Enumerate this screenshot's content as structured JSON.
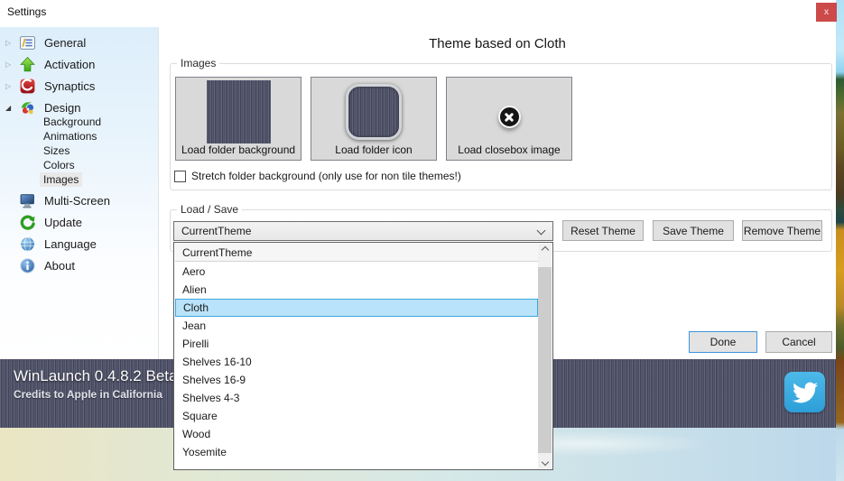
{
  "window": {
    "title": "Settings",
    "close_glyph": "x"
  },
  "sidebar": {
    "items": [
      {
        "label": "General"
      },
      {
        "label": "Activation"
      },
      {
        "label": "Synaptics"
      },
      {
        "label": "Design"
      },
      {
        "label": "Background"
      },
      {
        "label": "Animations"
      },
      {
        "label": "Sizes"
      },
      {
        "label": "Colors"
      },
      {
        "label": "Images"
      },
      {
        "label": "Multi-Screen"
      },
      {
        "label": "Update"
      },
      {
        "label": "Language"
      },
      {
        "label": "About"
      }
    ],
    "selected": "Images"
  },
  "main": {
    "heading": "Theme based on Cloth",
    "images_group": {
      "label": "Images",
      "buttons": [
        {
          "label": "Load folder background"
        },
        {
          "label": "Load folder icon"
        },
        {
          "label": "Load closebox image"
        }
      ],
      "stretch_checkbox": {
        "label": "Stretch folder background (only use for non tile themes!)",
        "checked": false
      }
    },
    "loadsave_group": {
      "label": "Load / Save",
      "combobox_value": "CurrentTheme",
      "reset_button": "Reset Theme",
      "save_button": "Save Theme",
      "remove_button": "Remove Theme"
    },
    "theme_dropdown": {
      "items": [
        "CurrentTheme",
        "Aero",
        "Alien",
        "Cloth",
        "Jean",
        "Pirelli",
        "Shelves 16-10",
        "Shelves 16-9",
        "Shelves 4-3",
        "Square",
        "Wood",
        "Yosemite"
      ],
      "highlighted": "Cloth"
    },
    "done_button": "Done",
    "cancel_button": "Cancel"
  },
  "footer": {
    "app_version": "WinLaunch 0.4.8.2 Beta",
    "credits": "Credits to Apple in California"
  },
  "colors": {
    "accent_blue": "#0078d7",
    "list_highlight": "#b9e3fa",
    "list_highlight_border": "#3ba7dd",
    "close_red": "#cc4a4a",
    "twitter_blue": "#36a6dd",
    "denim": "#4c4e62"
  }
}
